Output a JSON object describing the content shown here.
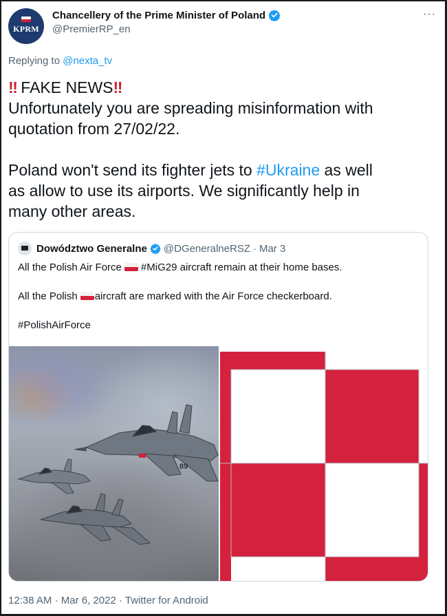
{
  "tweet": {
    "display_name": "Chancellery of the Prime Minister of Poland",
    "handle": "@PremierRP_en",
    "avatar_text": "KPRM",
    "more_label": "···",
    "replying_prefix": "Replying to",
    "replying_to": "@nexta_tv",
    "text": {
      "bang_left": "‼",
      "headline": "FAKE NEWS",
      "bang_right": "‼",
      "line2": "Unfortunately you are spreading misinformation with",
      "line3": "quotation from 27/02/22.",
      "line4_a": "Poland won't send its fighter jets to ",
      "line4_hashtag": "#Ukraine",
      "line4_b": " as well",
      "line5": "as allow to use its airports. We significantly help in",
      "line6": "many other areas."
    },
    "footer": {
      "time": "12:38 AM",
      "date": "Mar 6, 2022",
      "source": "Twitter for Android",
      "separator": "·"
    }
  },
  "quote": {
    "display_name": "Dowództwo Generalne",
    "handle": "@DGeneralneRSZ",
    "date": "Mar 3",
    "separator": "·",
    "line1_a": "All the Polish Air Force",
    "line1_b": "#MiG29 aircraft remain at their home bases.",
    "line2_a": "All the Polish",
    "line2_b": "aircraft are marked with the Air Force checkerboard.",
    "line3": "#PolishAirForce",
    "aircraft_tail_number": "89",
    "media": [
      "fighter-jets-photo",
      "checkerboard-insignia"
    ]
  },
  "colors": {
    "link": "#1d9bf0",
    "secondary_text": "#536471",
    "checker_red": "#d4213d",
    "avatar_bg": "#1e3a6e"
  }
}
